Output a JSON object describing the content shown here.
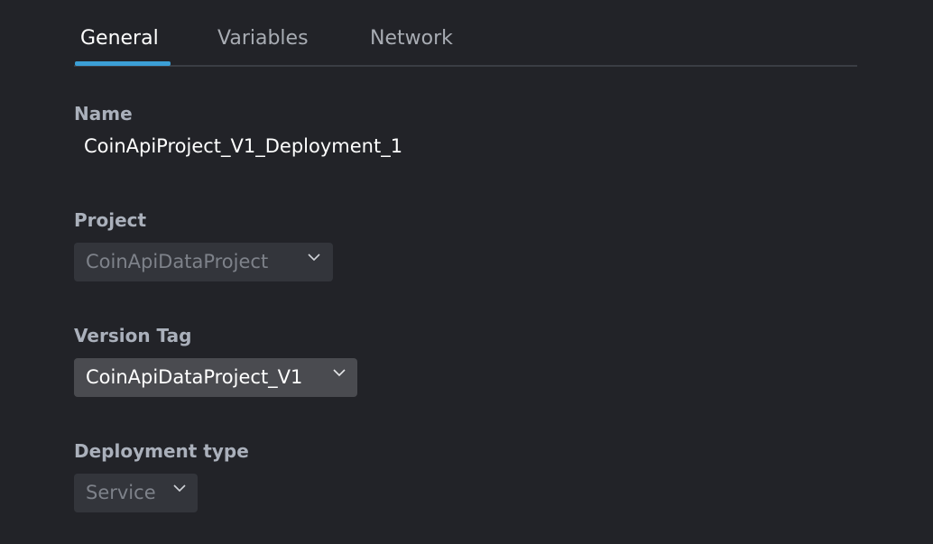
{
  "tabs": [
    {
      "label": "General",
      "active": true
    },
    {
      "label": "Variables",
      "active": false
    },
    {
      "label": "Network",
      "active": false
    }
  ],
  "fields": {
    "name": {
      "label": "Name",
      "value": "CoinApiProject_V1_Deployment_1"
    },
    "project": {
      "label": "Project",
      "value": "CoinApiDataProject",
      "disabled": true
    },
    "version_tag": {
      "label": "Version Tag",
      "value": "CoinApiDataProject_V1",
      "disabled": false
    },
    "deployment_type": {
      "label": "Deployment type",
      "value": "Service",
      "disabled": true
    }
  },
  "icons": {
    "dropdown": "chevron-down-icon"
  },
  "colors": {
    "background": "#222328",
    "accent": "#3b9fd6",
    "label": "#aab0bb"
  }
}
